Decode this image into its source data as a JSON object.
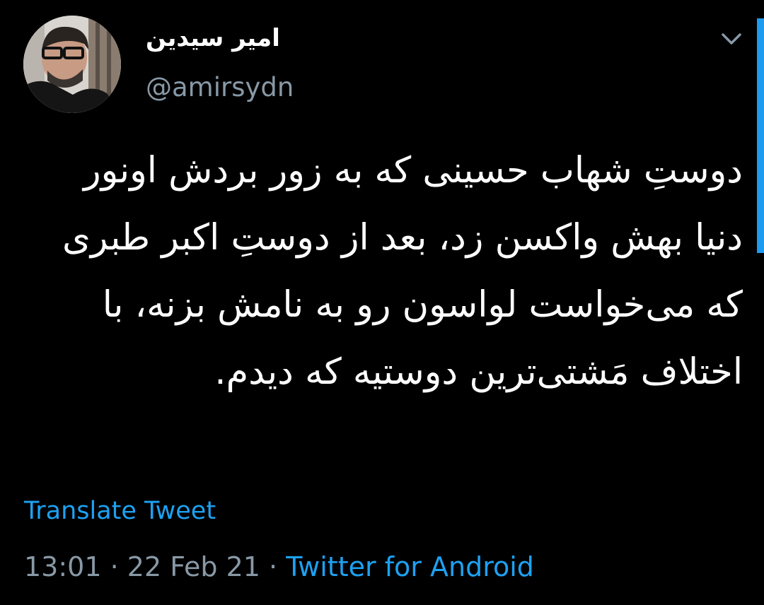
{
  "user": {
    "display_name": "امیر سیدین",
    "handle": "@amirsydn"
  },
  "tweet": {
    "text": "دوستِ شهاب حسینی که به زور بردش اونور دنیا بهش واکسن زد، بعد از دوستِ اکبر طبری که می‌خواست لواسون رو به نامش بزنه، با اختلاف مَشتی‌ترین دوستیه که دیدم.",
    "translate_label": "Translate Tweet",
    "time": "13:01",
    "separator": "·",
    "date": "22 Feb 21",
    "source": "Twitter for Android"
  },
  "icons": {
    "more": "chevron-down-icon"
  },
  "colors": {
    "background": "#000000",
    "text": "#ffffff",
    "muted": "#8899a6",
    "link": "#1da1f2"
  }
}
